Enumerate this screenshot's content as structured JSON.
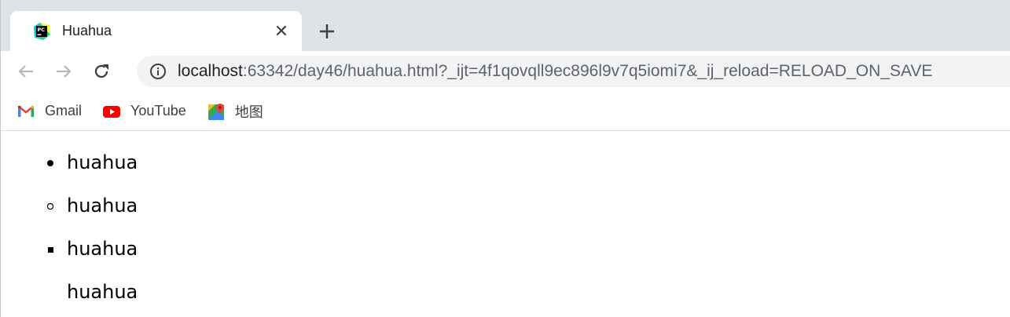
{
  "tab": {
    "title": "Huahua",
    "close_glyph": "✕",
    "favicon": "pycharm-icon"
  },
  "toolbar": {
    "url_host": "localhost",
    "url_rest": ":63342/day46/huahua.html?_ijt=4f1qovqll9ec896l9v7q5iomi7&_ij_reload=RELOAD_ON_SAVE"
  },
  "bookmarks": [
    {
      "label": "Gmail",
      "icon": "gmail-icon"
    },
    {
      "label": "YouTube",
      "icon": "youtube-icon"
    },
    {
      "label": "地图",
      "icon": "maps-icon"
    }
  ],
  "list": [
    {
      "text": "huahua",
      "marker": "disc"
    },
    {
      "text": "huahua",
      "marker": "circle"
    },
    {
      "text": "huahua",
      "marker": "square"
    },
    {
      "text": "huahua",
      "marker": "none"
    }
  ]
}
